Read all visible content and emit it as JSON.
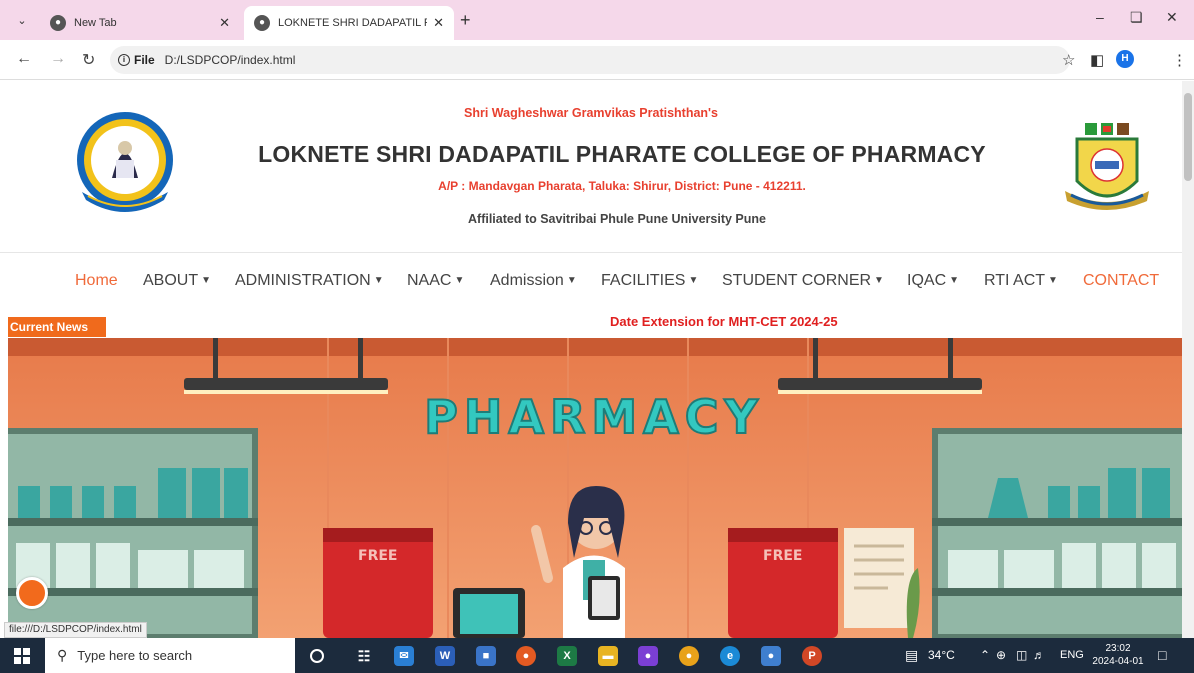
{
  "browser": {
    "tabs": [
      {
        "title": "New Tab",
        "active": false
      },
      {
        "title": "LOKNETE SHRI DADAPATIL PHA",
        "active": true
      }
    ],
    "new_tab": "+",
    "address": {
      "chip": "File",
      "url": "D:/LSDPCOP/index.html"
    },
    "profile_initial": "H",
    "status_url": "file:///D:/LSDPCOP/index.html"
  },
  "header": {
    "trust_name": "Shri Wagheshwar Gramvikas Pratishthan's",
    "college_name": "LOKNETE SHRI DADAPATIL PHARATE COLLEGE OF PHARMACY",
    "address": "A/P : Mandavgan Pharata, Taluka: Shirur, District: Pune - 412211.",
    "affiliation": "Affiliated to Savitribai Phule Pune University Pune"
  },
  "nav": {
    "items": [
      {
        "label": "Home",
        "dropdown": false
      },
      {
        "label": "ABOUT",
        "dropdown": true
      },
      {
        "label": "ADMINISTRATION",
        "dropdown": true
      },
      {
        "label": "NAAC",
        "dropdown": true
      },
      {
        "label": "Admission",
        "dropdown": true
      },
      {
        "label": "FACILITIES",
        "dropdown": true
      },
      {
        "label": "STUDENT CORNER",
        "dropdown": true
      },
      {
        "label": "IQAC",
        "dropdown": true
      },
      {
        "label": "RTI ACT",
        "dropdown": true
      },
      {
        "label": "CONTACT",
        "dropdown": false
      }
    ],
    "accent_color": "#f06a3a"
  },
  "news": {
    "label": "Current News",
    "text": "Date Extension for MHT-CET 2024-25"
  },
  "banner": {
    "sign": "PHARMACY",
    "box_label": "FREE"
  },
  "taskbar": {
    "search_placeholder": "Type here to search",
    "weather": "34°C",
    "language": "ENG",
    "time": "23:02",
    "date": "2024-04-01"
  },
  "colors": {
    "tabbar_bg": "#f5d8ea",
    "news_label_bg": "#f06a1c",
    "news_text": "#e02020",
    "header_red": "#e8402f",
    "taskbar_bg": "#1c2b3d"
  }
}
